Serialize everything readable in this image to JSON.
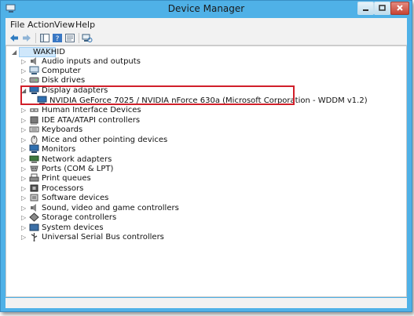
{
  "window": {
    "title": "Device Manager"
  },
  "menu": [
    "File",
    "Action",
    "View",
    "Help"
  ],
  "tree": {
    "root": "WAKHID",
    "categories": [
      "Audio inputs and outputs",
      "Computer",
      "Disk drives",
      "Display adapters",
      "Human Interface Devices",
      "IDE ATA/ATAPI controllers",
      "Keyboards",
      "Mice and other pointing devices",
      "Monitors",
      "Network adapters",
      "Ports (COM & LPT)",
      "Print queues",
      "Processors",
      "Software devices",
      "Sound, video and game controllers",
      "Storage controllers",
      "System devices",
      "Universal Serial Bus controllers"
    ],
    "display_device": "NVIDIA GeForce 7025 / NVIDIA nForce 630a (Microsoft Corporation - WDDM v1.2)"
  },
  "colors": {
    "frame": "#4fb1e7",
    "highlight_box": "#d11f2a",
    "selection": "#cfe7fb"
  }
}
